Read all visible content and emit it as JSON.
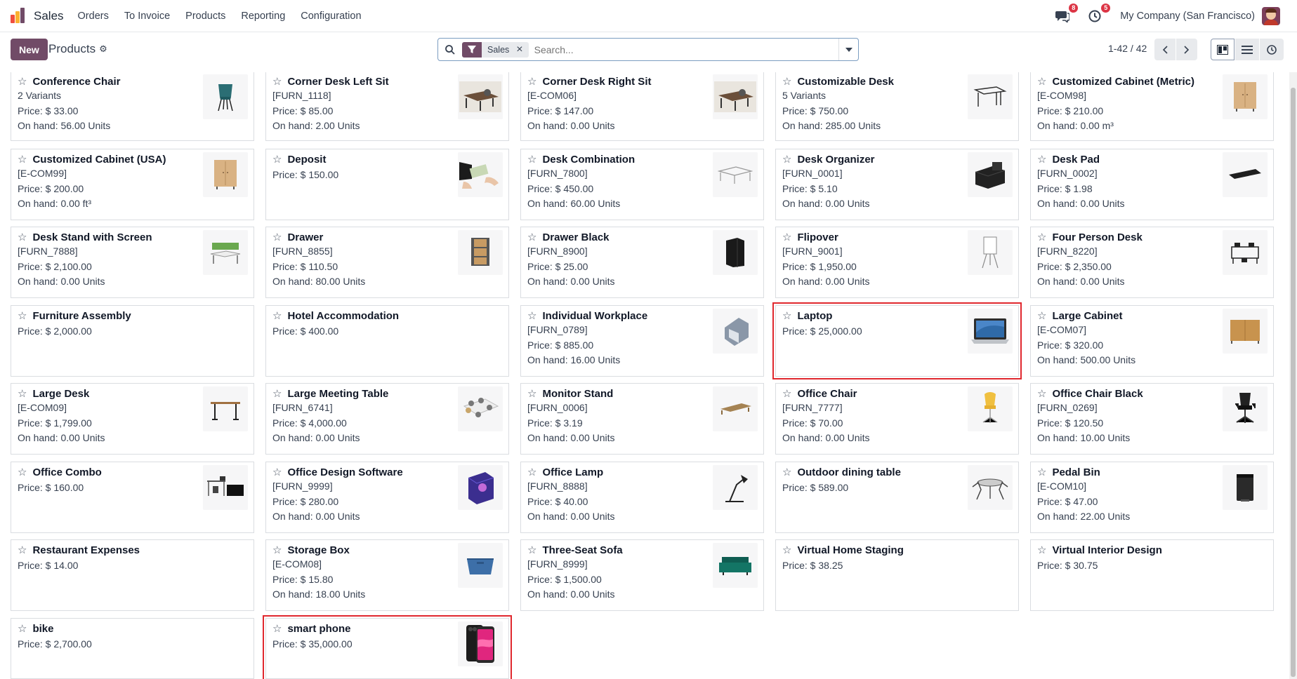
{
  "app": {
    "name": "Sales",
    "menu": [
      "Orders",
      "To Invoice",
      "Products",
      "Reporting",
      "Configuration"
    ],
    "logo_colors": [
      "#f04e3e",
      "#fbb130",
      "#714B67"
    ]
  },
  "systray": {
    "messages_count": "8",
    "activities_count": "5",
    "company": "My Company (San Francisco)"
  },
  "control": {
    "new_label": "New",
    "breadcrumb": "Products",
    "search": {
      "facet": "Sales",
      "placeholder": "Search..."
    },
    "pager": "1-42 / 42"
  },
  "products": [
    {
      "name": "Conference Chair",
      "ref": "2 Variants",
      "price": "Price: $ 33.00",
      "onhand": "On hand: 56.00 Units",
      "img": "chair"
    },
    {
      "name": "Corner Desk Left Sit",
      "ref": "[FURN_1118]",
      "price": "Price: $ 85.00",
      "onhand": "On hand: 2.00 Units",
      "img": "desk-photo"
    },
    {
      "name": "Corner Desk Right Sit",
      "ref": "[E-COM06]",
      "price": "Price: $ 147.00",
      "onhand": "On hand: 0.00 Units",
      "img": "desk-photo"
    },
    {
      "name": "Customizable Desk",
      "ref": "5 Variants",
      "price": "Price: $ 750.00",
      "onhand": "On hand: 285.00 Units",
      "img": "desk-white"
    },
    {
      "name": "Customized Cabinet (Metric)",
      "ref": "[E-COM98]",
      "price": "Price: $ 210.00",
      "onhand": "On hand: 0.00 m³",
      "img": "cabinet"
    },
    {
      "name": "Customized Cabinet (USA)",
      "ref": "[E-COM99]",
      "price": "Price: $ 200.00",
      "onhand": "On hand: 0.00 ft³",
      "img": "cabinet"
    },
    {
      "name": "Deposit",
      "ref": "",
      "price": "Price: $ 150.00",
      "onhand": "",
      "img": "money"
    },
    {
      "name": "Desk Combination",
      "ref": "[FURN_7800]",
      "price": "Price: $ 450.00",
      "onhand": "On hand: 60.00 Units",
      "img": "desk-combo"
    },
    {
      "name": "Desk Organizer",
      "ref": "[FURN_0001]",
      "price": "Price: $ 5.10",
      "onhand": "On hand: 0.00 Units",
      "img": "organizer"
    },
    {
      "name": "Desk Pad",
      "ref": "[FURN_0002]",
      "price": "Price: $ 1.98",
      "onhand": "On hand: 0.00 Units",
      "img": "pad"
    },
    {
      "name": "Desk Stand with Screen",
      "ref": "[FURN_7888]",
      "price": "Price: $ 2,100.00",
      "onhand": "On hand: 0.00 Units",
      "img": "stand-screen"
    },
    {
      "name": "Drawer",
      "ref": "[FURN_8855]",
      "price": "Price: $ 110.50",
      "onhand": "On hand: 80.00 Units",
      "img": "drawer"
    },
    {
      "name": "Drawer Black",
      "ref": "[FURN_8900]",
      "price": "Price: $ 25.00",
      "onhand": "On hand: 0.00 Units",
      "img": "drawer-black"
    },
    {
      "name": "Flipover",
      "ref": "[FURN_9001]",
      "price": "Price: $ 1,950.00",
      "onhand": "On hand: 0.00 Units",
      "img": "flipover"
    },
    {
      "name": "Four Person Desk",
      "ref": "[FURN_8220]",
      "price": "Price: $ 2,350.00",
      "onhand": "On hand: 0.00 Units",
      "img": "four-desk"
    },
    {
      "name": "Furniture Assembly",
      "ref": "",
      "price": "Price: $ 2,000.00",
      "onhand": "",
      "img": ""
    },
    {
      "name": "Hotel Accommodation",
      "ref": "",
      "price": "Price: $ 400.00",
      "onhand": "",
      "img": ""
    },
    {
      "name": "Individual Workplace",
      "ref": "[FURN_0789]",
      "price": "Price: $ 885.00",
      "onhand": "On hand: 16.00 Units",
      "img": "workplace"
    },
    {
      "name": "Laptop",
      "ref": "",
      "price": "Price: $ 25,000.00",
      "onhand": "",
      "img": "laptop",
      "highlight": true
    },
    {
      "name": "Large Cabinet",
      "ref": "[E-COM07]",
      "price": "Price: $ 320.00",
      "onhand": "On hand: 500.00 Units",
      "img": "large-cabinet"
    },
    {
      "name": "Large Desk",
      "ref": "[E-COM09]",
      "price": "Price: $ 1,799.00",
      "onhand": "On hand: 0.00 Units",
      "img": "large-desk"
    },
    {
      "name": "Large Meeting Table",
      "ref": "[FURN_6741]",
      "price": "Price: $ 4,000.00",
      "onhand": "On hand: 0.00 Units",
      "img": "meeting-table"
    },
    {
      "name": "Monitor Stand",
      "ref": "[FURN_0006]",
      "price": "Price: $ 3.19",
      "onhand": "On hand: 0.00 Units",
      "img": "monitor-stand"
    },
    {
      "name": "Office Chair",
      "ref": "[FURN_7777]",
      "price": "Price: $ 70.00",
      "onhand": "On hand: 0.00 Units",
      "img": "office-chair"
    },
    {
      "name": "Office Chair Black",
      "ref": "[FURN_0269]",
      "price": "Price: $ 120.50",
      "onhand": "On hand: 10.00 Units",
      "img": "office-chair-black"
    },
    {
      "name": "Office Combo",
      "ref": "",
      "price": "Price: $ 160.00",
      "onhand": "",
      "img": "office-combo"
    },
    {
      "name": "Office Design Software",
      "ref": "[FURN_9999]",
      "price": "Price: $ 280.00",
      "onhand": "On hand: 0.00 Units",
      "img": "software"
    },
    {
      "name": "Office Lamp",
      "ref": "[FURN_8888]",
      "price": "Price: $ 40.00",
      "onhand": "On hand: 0.00 Units",
      "img": "lamp"
    },
    {
      "name": "Outdoor dining table",
      "ref": "",
      "price": "Price: $ 589.00",
      "onhand": "",
      "img": "outdoor-table"
    },
    {
      "name": "Pedal Bin",
      "ref": "[E-COM10]",
      "price": "Price: $ 47.00",
      "onhand": "On hand: 22.00 Units",
      "img": "bin"
    },
    {
      "name": "Restaurant Expenses",
      "ref": "",
      "price": "Price: $ 14.00",
      "onhand": "",
      "img": ""
    },
    {
      "name": "Storage Box",
      "ref": "[E-COM08]",
      "price": "Price: $ 15.80",
      "onhand": "On hand: 18.00 Units",
      "img": "storage-box"
    },
    {
      "name": "Three-Seat Sofa",
      "ref": "[FURN_8999]",
      "price": "Price: $ 1,500.00",
      "onhand": "On hand: 0.00 Units",
      "img": "sofa"
    },
    {
      "name": "Virtual Home Staging",
      "ref": "",
      "price": "Price: $ 38.25",
      "onhand": "",
      "img": ""
    },
    {
      "name": "Virtual Interior Design",
      "ref": "",
      "price": "Price: $ 30.75",
      "onhand": "",
      "img": ""
    },
    {
      "name": "bike",
      "ref": "",
      "price": "Price: $ 2,700.00",
      "onhand": "",
      "img": ""
    },
    {
      "name": "smart phone",
      "ref": "",
      "price": "Price: $ 35,000.00",
      "onhand": "",
      "img": "phone",
      "highlight": true
    }
  ],
  "colors": {
    "brand": "#714B67",
    "highlight_border": "#e0282e",
    "badge": "#dc3545"
  }
}
